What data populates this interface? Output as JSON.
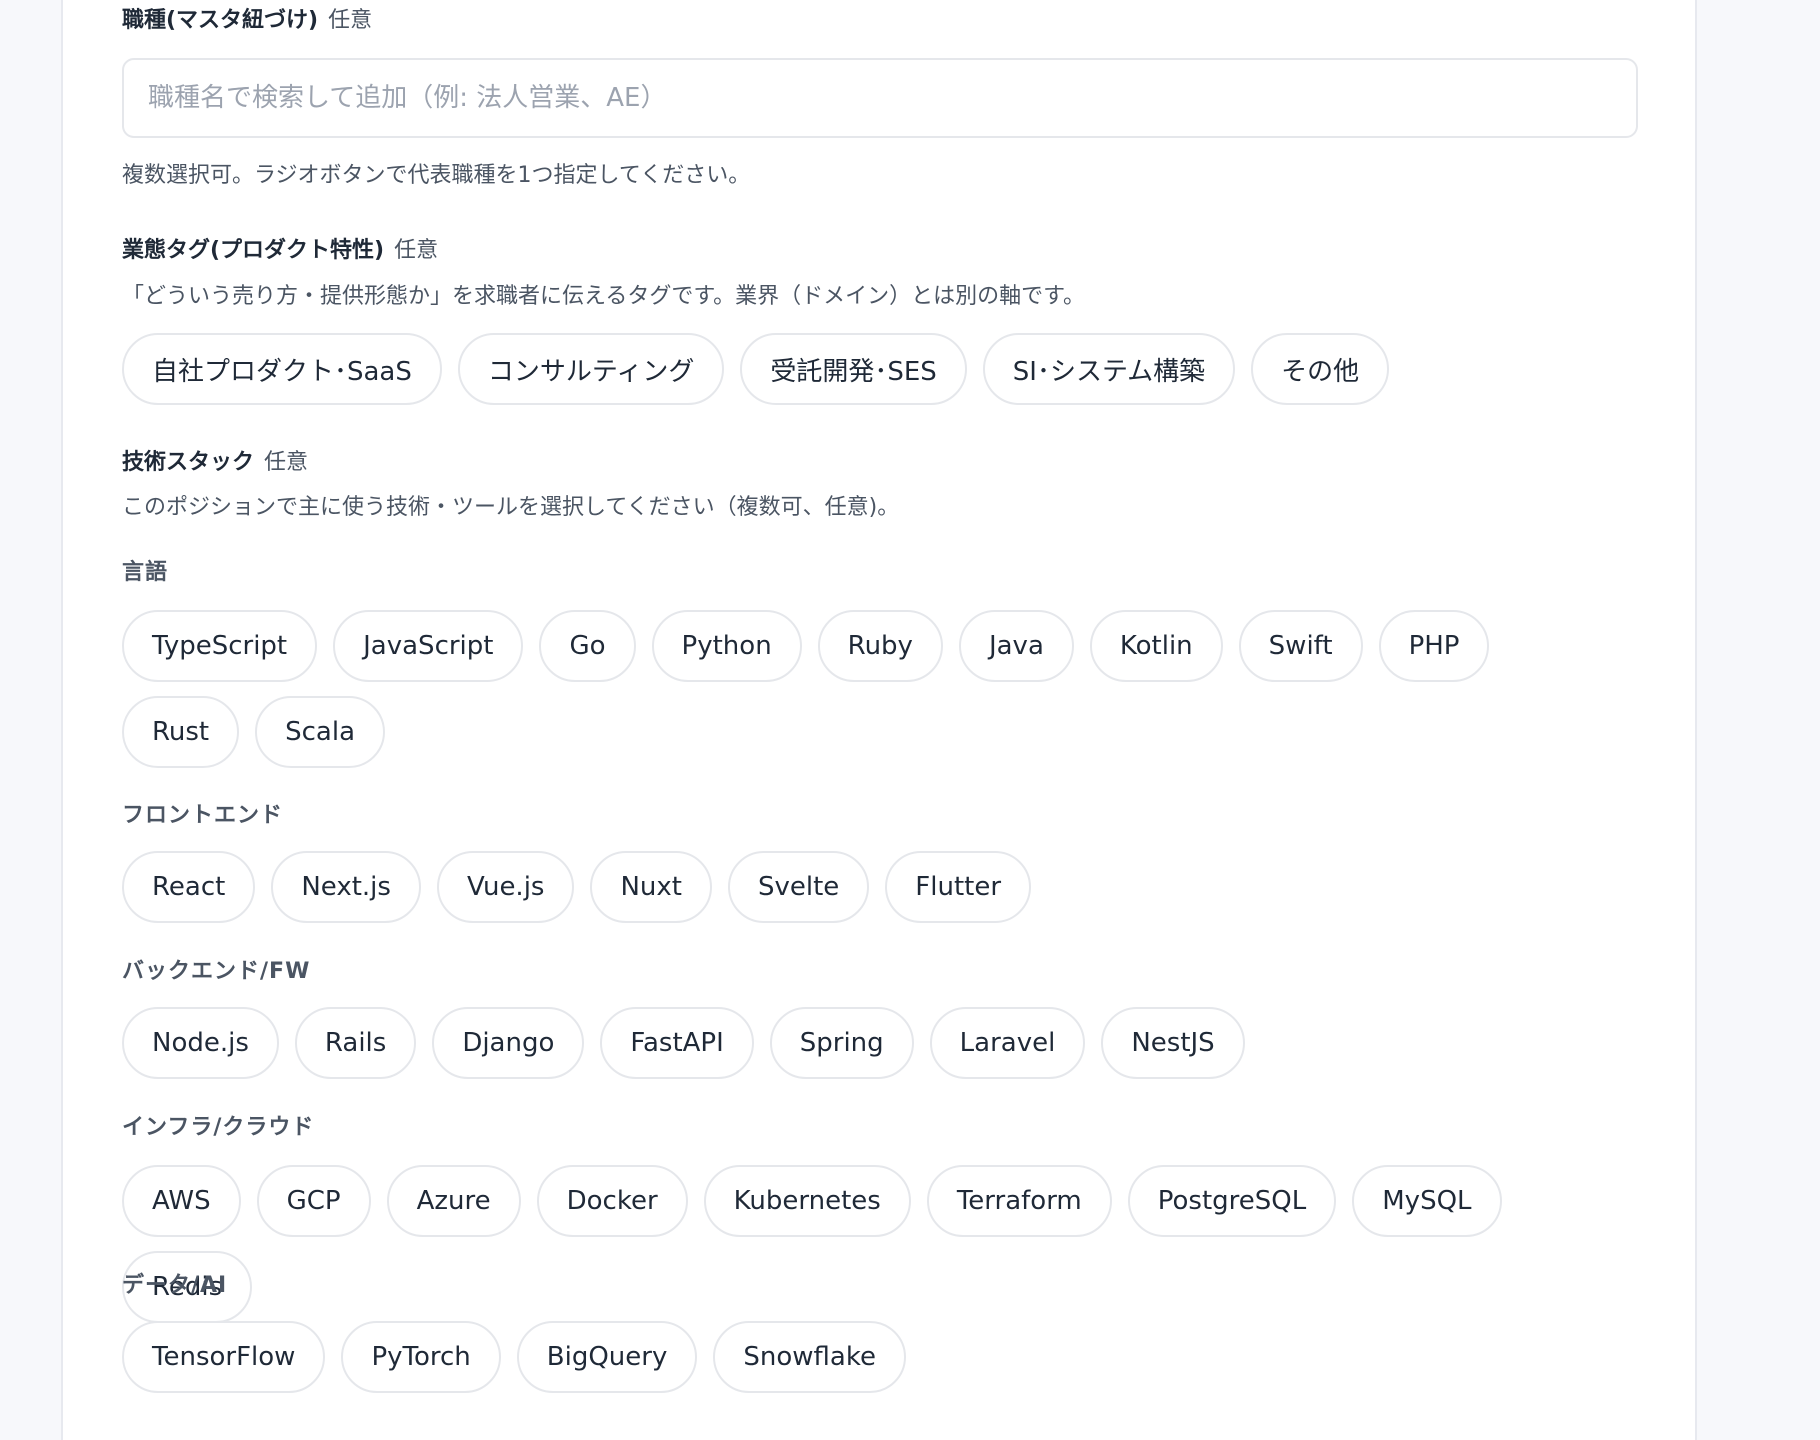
{
  "job_type": {
    "title": "職種(マスタ紐づけ)",
    "optional": "任意",
    "placeholder": "職種名で検索して追加（例: 法人営業、AE）",
    "help": "複数選択可。ラジオボタンで代表職種を1つ指定してください。"
  },
  "business_tags": {
    "title": "業態タグ(プロダクト特性)",
    "optional": "任意",
    "help": "「どういう売り方・提供形態か」を求職者に伝えるタグです。業界（ドメイン）とは別の軸です。",
    "chips": [
      "自社プロダクト･SaaS",
      "コンサルティング",
      "受託開発･SES",
      "SI･システム構築",
      "その他"
    ]
  },
  "tech_stack": {
    "title": "技術スタック",
    "optional": "任意",
    "help": "このポジションで主に使う技術・ツールを選択してください（複数可、任意)。",
    "groups": [
      {
        "label": "言語",
        "chips": [
          "TypeScript",
          "JavaScript",
          "Go",
          "Python",
          "Ruby",
          "Java",
          "Kotlin",
          "Swift",
          "PHP",
          "Rust",
          "Scala"
        ]
      },
      {
        "label": "フロントエンド",
        "chips": [
          "React",
          "Next.js",
          "Vue.js",
          "Nuxt",
          "Svelte",
          "Flutter"
        ]
      },
      {
        "label": "バックエンド/FW",
        "chips": [
          "Node.js",
          "Rails",
          "Django",
          "FastAPI",
          "Spring",
          "Laravel",
          "NestJS"
        ]
      },
      {
        "label": "インフラ/クラウド",
        "chips": [
          "AWS",
          "GCP",
          "Azure",
          "Docker",
          "Kubernetes",
          "Terraform",
          "PostgreSQL",
          "MySQL",
          "Redis"
        ]
      },
      {
        "label": "データ/AI",
        "chips": [
          "TensorFlow",
          "PyTorch",
          "BigQuery",
          "Snowflake"
        ]
      }
    ]
  }
}
